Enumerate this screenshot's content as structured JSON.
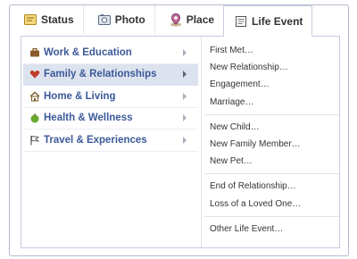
{
  "tabs": [
    {
      "label": "Status",
      "icon": "status-icon"
    },
    {
      "label": "Photo",
      "icon": "photo-icon"
    },
    {
      "label": "Place",
      "icon": "place-icon"
    },
    {
      "label": "Life Event",
      "icon": "life-event-icon",
      "active": true
    }
  ],
  "categories": [
    {
      "label": "Work & Education",
      "icon": "briefcase-icon"
    },
    {
      "label": "Family & Relationships",
      "icon": "heart-icon",
      "selected": true
    },
    {
      "label": "Home & Living",
      "icon": "house-icon"
    },
    {
      "label": "Health & Wellness",
      "icon": "apple-icon"
    },
    {
      "label": "Travel & Experiences",
      "icon": "flag-icon"
    }
  ],
  "events": {
    "group1": [
      "First Met…",
      "New Relationship…",
      "Engagement…",
      "Marriage…"
    ],
    "group2": [
      "New Child…",
      "New Family Member…",
      "New Pet…"
    ],
    "group3": [
      "End of Relationship…",
      "Loss of a Loved One…"
    ],
    "group4": [
      "Other Life Event…"
    ]
  },
  "colors": {
    "link": "#3b5998",
    "selected_bg": "#dde3ee",
    "border": "#c4cde0"
  }
}
